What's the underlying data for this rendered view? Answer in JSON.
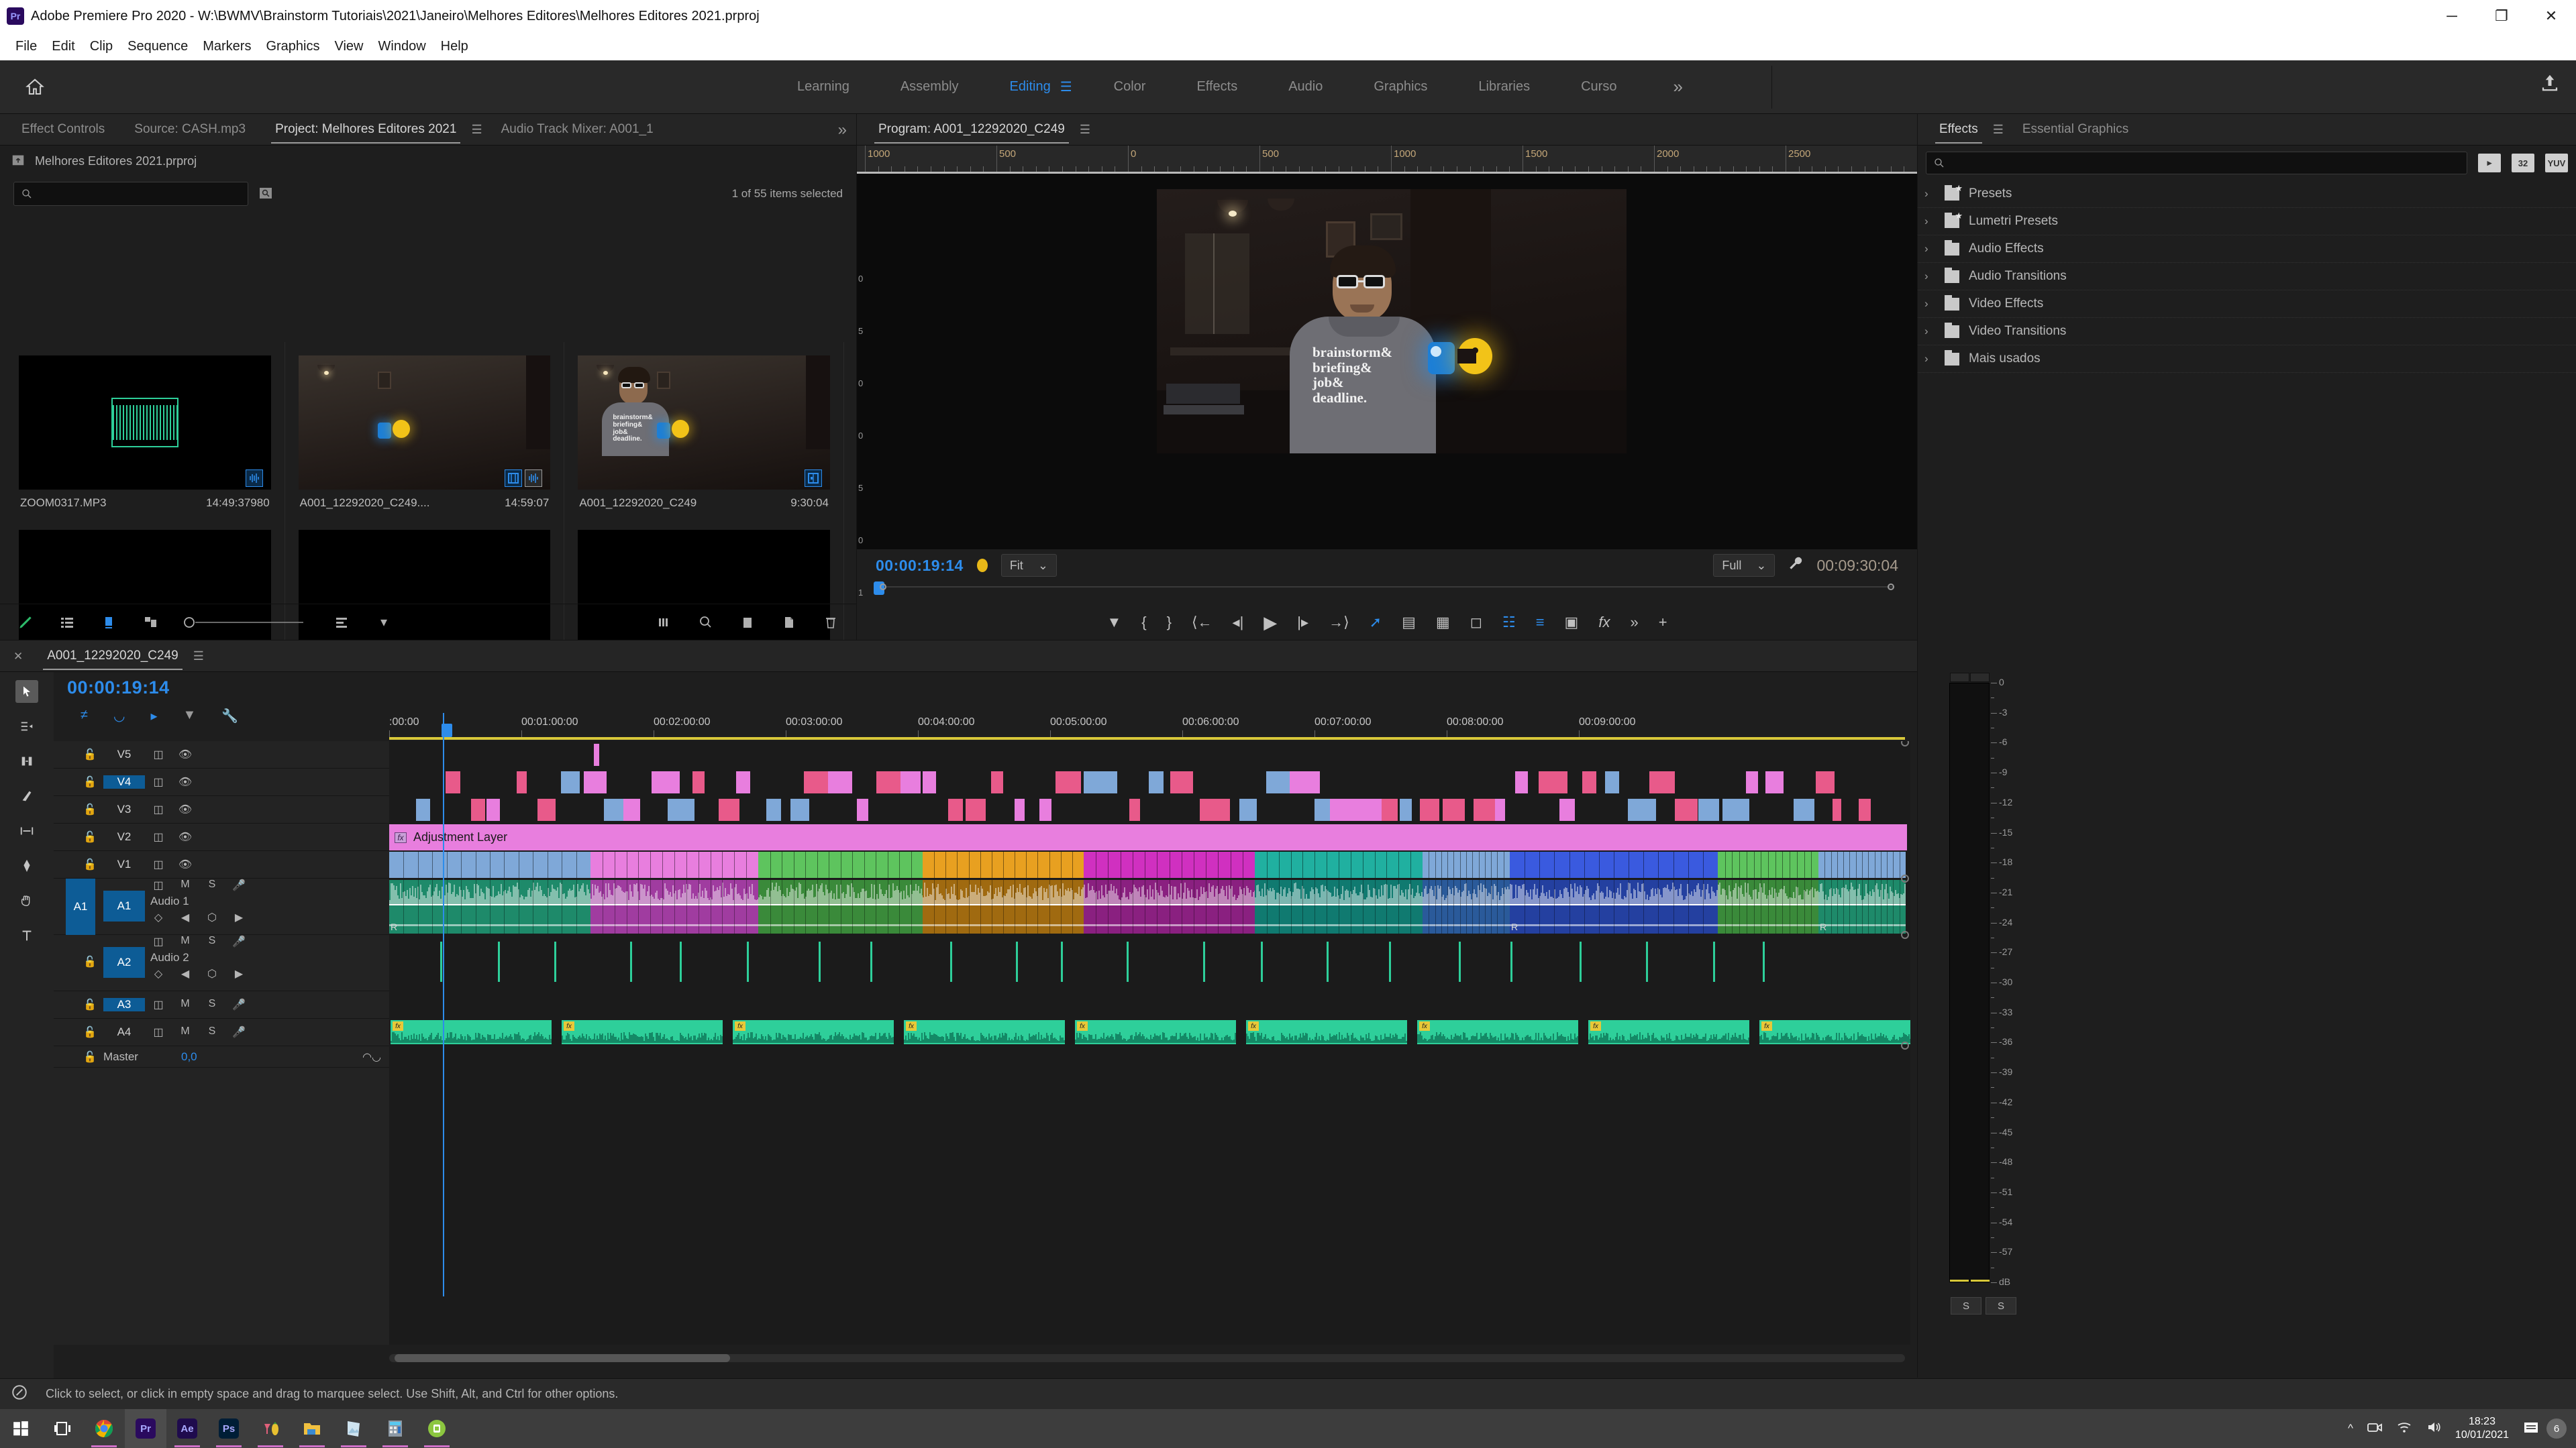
{
  "window": {
    "app_logo": "Pr",
    "title": "Adobe Premiere Pro 2020 - W:\\BWMV\\Brainstorm Tutoriais\\2021\\Janeiro\\Melhores Editores\\Melhores Editores 2021.prproj",
    "minimize": "─",
    "maximize": "❐",
    "close": "✕"
  },
  "menubar": {
    "items": [
      "File",
      "Edit",
      "Clip",
      "Sequence",
      "Markers",
      "Graphics",
      "View",
      "Window",
      "Help"
    ]
  },
  "workspace": {
    "home_icon": "home-icon",
    "tabs": [
      {
        "label": "Learning",
        "active": false
      },
      {
        "label": "Assembly",
        "active": false
      },
      {
        "label": "Editing",
        "active": true
      },
      {
        "label": "Color",
        "active": false
      },
      {
        "label": "Effects",
        "active": false
      },
      {
        "label": "Audio",
        "active": false
      },
      {
        "label": "Graphics",
        "active": false
      },
      {
        "label": "Libraries",
        "active": false
      },
      {
        "label": "Curso",
        "active": false
      }
    ],
    "overflow": "»",
    "menu_glyph": "☰",
    "share_icon": "share-icon"
  },
  "project_panel": {
    "tabs": [
      {
        "label": "Effect Controls",
        "active": false
      },
      {
        "label": "Source: CASH.mp3",
        "active": false
      },
      {
        "label": "Project: Melhores Editores 2021",
        "active": true
      },
      {
        "label": "Audio Track Mixer: A001_1",
        "active": false
      }
    ],
    "overflow": "»",
    "menu_glyph": "☰",
    "path_label": "Melhores Editores 2021.prproj",
    "search_placeholder": "",
    "selection_status": "1 of 55 items selected",
    "items": [
      {
        "name": "ZOOM0317.MP3",
        "duration": "14:49:37980",
        "kind": "audio",
        "badges": [
          "audio-badge"
        ]
      },
      {
        "name": "A001_12292020_C249....",
        "duration": "14:59:07",
        "kind": "video",
        "badges": [
          "video-badge",
          "audio-badge"
        ]
      },
      {
        "name": "A001_12292020_C249",
        "duration": "9:30:04",
        "kind": "video",
        "badges": [
          "mixed-badge"
        ]
      },
      {
        "name": "",
        "duration": "",
        "kind": "empty",
        "badges": [
          "audio-badge"
        ]
      },
      {
        "name": "",
        "duration": "",
        "kind": "empty",
        "badges": [
          "video-badge",
          "audio-badge"
        ]
      },
      {
        "name": "",
        "duration": "",
        "kind": "empty",
        "badges": [
          "video-badge",
          "audio-badge"
        ]
      }
    ],
    "toolbar_icons": [
      "pen-icon",
      "list-view-icon",
      "icon-view-icon",
      "freeform-view-icon",
      "zoom-slider-icon",
      "sort-icon",
      "chevron-down-icon",
      "find-columns-icon",
      "search-icon",
      "new-bin-icon",
      "new-item-icon",
      "delete-icon"
    ]
  },
  "program_monitor": {
    "title": "Program: A001_12292020_C249",
    "menu_glyph": "☰",
    "ruler_labels": [
      "1000",
      "500",
      "0",
      "500",
      "1000",
      "1500",
      "2000",
      "2500"
    ],
    "side_ruler_labels": [
      "0",
      "5",
      "0",
      "0",
      "5",
      "0",
      "1"
    ],
    "current_timecode": "00:00:19:14",
    "zoom_level": "Fit",
    "resolution": "Full",
    "duration_timecode": "00:09:30:04",
    "settings_icon": "wrench-icon",
    "dropdown_glyph": "⌄",
    "transport_icons": [
      "add-marker-icon",
      "mark-in-icon",
      "mark-out-icon",
      "go-to-in-icon",
      "step-back-icon",
      "play-icon",
      "step-forward-icon",
      "go-to-out-icon",
      "export-frame-icon",
      "lift-icon",
      "extract-icon",
      "camera-icon",
      "safe-margins-icon",
      "comparison-view-icon",
      "multicam-icon",
      "fx-icon",
      "more-icon",
      "plus-icon"
    ]
  },
  "effects_panel": {
    "tabs": [
      {
        "label": "Effects",
        "active": true
      },
      {
        "label": "Essential Graphics",
        "active": false
      }
    ],
    "menu_glyph": "☰",
    "search_placeholder": "",
    "filter_buttons": [
      "accelerated-effect-icon",
      "32",
      "YUV"
    ],
    "tree": [
      {
        "label": "Presets",
        "icon": "preset-folder-icon"
      },
      {
        "label": "Lumetri Presets",
        "icon": "preset-folder-icon"
      },
      {
        "label": "Audio Effects",
        "icon": "folder-icon"
      },
      {
        "label": "Audio Transitions",
        "icon": "folder-icon"
      },
      {
        "label": "Video Effects",
        "icon": "folder-icon"
      },
      {
        "label": "Video Transitions",
        "icon": "folder-icon"
      },
      {
        "label": "Mais usados",
        "icon": "folder-icon"
      }
    ],
    "chevron": "›"
  },
  "timeline": {
    "close_glyph": "✕",
    "sequence_name": "A001_12292020_C249",
    "menu_glyph": "☰",
    "playhead_timecode": "00:00:19:14",
    "header_icons": [
      "nest-toggle-icon",
      "snap-icon",
      "linked-selection-icon",
      "marker-icon",
      "wrench-icon"
    ],
    "tools": [
      "selection-tool",
      "track-select-tool",
      "ripple-edit-tool",
      "razor-tool",
      "slip-tool",
      "pen-tool",
      "hand-tool",
      "type-tool"
    ],
    "ruler_labels": [
      ":00:00",
      "00:01:00:00",
      "00:02:00:00",
      "00:03:00:00",
      "00:04:00:00",
      "00:05:00:00",
      "00:06:00:00",
      "00:07:00:00",
      "00:08:00:00",
      "00:09:00:00"
    ],
    "video_tracks": [
      {
        "name": "V5",
        "selected": false,
        "lock": "lock-icon",
        "sync": "sync-lock-icon",
        "eye": "eye-icon"
      },
      {
        "name": "V4",
        "selected": true,
        "lock": "lock-icon",
        "sync": "sync-lock-icon",
        "eye": "eye-icon"
      },
      {
        "name": "V3",
        "selected": false,
        "lock": "lock-icon",
        "sync": "sync-lock-icon",
        "eye": "eye-icon"
      },
      {
        "name": "V2",
        "selected": false,
        "lock": "lock-icon",
        "sync": "sync-lock-icon",
        "eye": "eye-icon"
      },
      {
        "name": "V1",
        "selected": false,
        "lock": "lock-icon",
        "sync": "sync-lock-icon",
        "eye": "eye-icon"
      }
    ],
    "audio_tracks": [
      {
        "name": "A1",
        "label": "Audio 1",
        "selected": true,
        "mute": "M",
        "solo": "S",
        "mic": "mic-icon",
        "tall": true
      },
      {
        "name": "A2",
        "label": "Audio 2",
        "selected": true,
        "mute": "M",
        "solo": "S",
        "mic": "mic-icon",
        "tall": true
      },
      {
        "name": "A3",
        "label": "",
        "selected": true,
        "mute": "M",
        "solo": "S",
        "mic": "mic-icon",
        "tall": false
      },
      {
        "name": "A4",
        "label": "",
        "selected": false,
        "mute": "M",
        "solo": "S",
        "mic": "mic-icon",
        "tall": false
      }
    ],
    "source_patches": [
      "A1"
    ],
    "master": {
      "name": "Master",
      "value": "0,0",
      "meter_icon": "meter-icon"
    },
    "clips": [
      {
        "track": "V2",
        "label": "Adjustment Layer",
        "icon": "fx-icon",
        "color": "#e87ede"
      }
    ]
  },
  "audio_meters": {
    "scale_labels": [
      "0",
      "-3",
      "-6",
      "-9",
      "-12",
      "-15",
      "-18",
      "-21",
      "-24",
      "-27",
      "-30",
      "-33",
      "-36",
      "-39",
      "-42",
      "-45",
      "-48",
      "-51",
      "-54",
      "-57",
      "dB"
    ],
    "solo_left": "S",
    "solo_right": "S"
  },
  "status_bar": {
    "icon": "tool-hint-icon",
    "text": "Click to select, or click in empty space and drag to marquee select. Use Shift, Alt, and Ctrl for other options."
  },
  "taskbar": {
    "start_icon": "windows-start-icon",
    "task_view_icon": "task-view-icon",
    "apps": [
      {
        "name": "chrome-icon",
        "label": "Ch",
        "active": false,
        "color": "#e8e8e8"
      },
      {
        "name": "premiere-pro-icon",
        "label": "Pr",
        "active": true,
        "color": "#2a0a5e"
      },
      {
        "name": "after-effects-icon",
        "label": "Ae",
        "active": false,
        "color": "#1f0b4d"
      },
      {
        "name": "photoshop-icon",
        "label": "Ps",
        "active": false,
        "color": "#001e36"
      },
      {
        "name": "drinks-icon",
        "label": "",
        "active": false,
        "color": "#d8a030"
      },
      {
        "name": "file-explorer-icon",
        "label": "",
        "active": false,
        "color": "#f0c040"
      },
      {
        "name": "photos-icon",
        "label": "",
        "active": false,
        "color": "#b8d8e8"
      },
      {
        "name": "calculator-icon",
        "label": "",
        "active": false,
        "color": "#7c8c9c"
      },
      {
        "name": "cloud-app-icon",
        "label": "",
        "active": false,
        "color": "#8cc63f"
      }
    ],
    "tray_icons": [
      "show-hidden-icons-chevron",
      "camera-icon",
      "wifi-icon",
      "volume-icon"
    ],
    "time": "18:23",
    "date": "10/01/2021",
    "notification_count": "6"
  }
}
